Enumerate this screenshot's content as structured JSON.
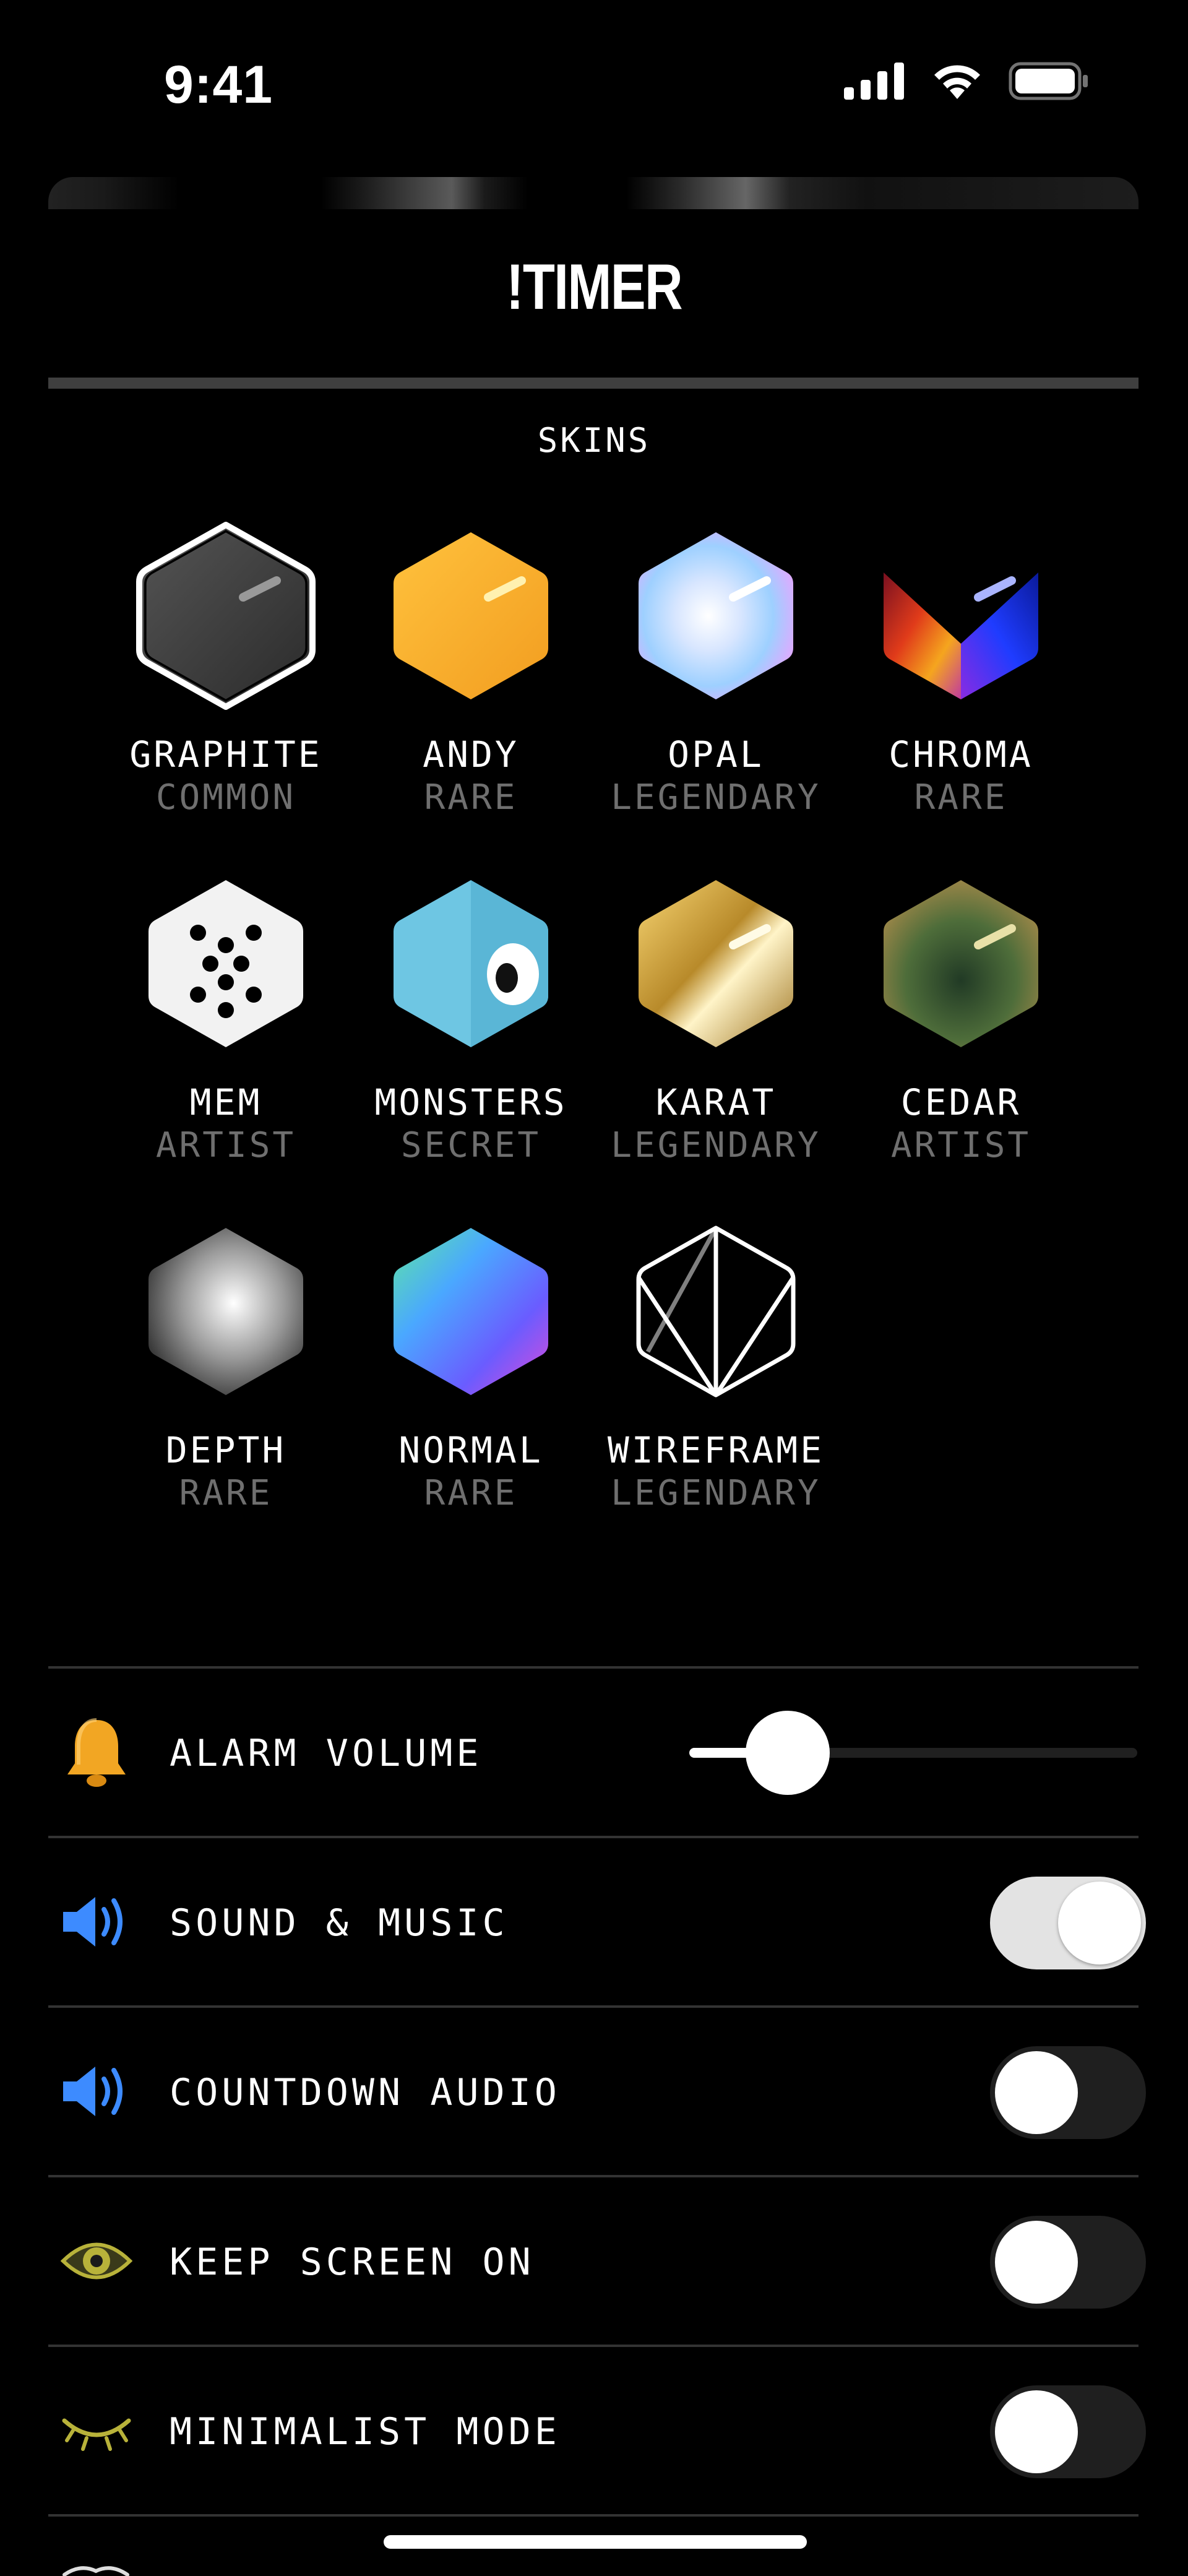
{
  "status_bar": {
    "time": "9:41"
  },
  "header": {
    "title": "!TIMER"
  },
  "skins": {
    "heading": "SKINS",
    "items": [
      {
        "name": "GRAPHITE",
        "rarity": "COMMON",
        "selected": true
      },
      {
        "name": "ANDY",
        "rarity": "RARE"
      },
      {
        "name": "OPAL",
        "rarity": "LEGENDARY"
      },
      {
        "name": "CHROMA",
        "rarity": "RARE"
      },
      {
        "name": "MEM",
        "rarity": "ARTIST"
      },
      {
        "name": "MONSTERS",
        "rarity": "SECRET"
      },
      {
        "name": "KARAT",
        "rarity": "LEGENDARY"
      },
      {
        "name": "CEDAR",
        "rarity": "ARTIST"
      },
      {
        "name": "DEPTH",
        "rarity": "RARE"
      },
      {
        "name": "NORMAL",
        "rarity": "RARE"
      },
      {
        "name": "WIREFRAME",
        "rarity": "LEGENDARY"
      }
    ]
  },
  "settings": {
    "alarm_volume": {
      "label": "ALARM VOLUME",
      "value": 0.22,
      "icon": "bell-icon"
    },
    "sound_music": {
      "label": "SOUND & MUSIC",
      "on": true,
      "icon": "speaker-icon"
    },
    "countdown_audio": {
      "label": "COUNTDOWN AUDIO",
      "on": false,
      "icon": "speaker-icon"
    },
    "keep_screen_on": {
      "label": "KEEP SCREEN ON",
      "on": false,
      "icon": "eye-icon"
    },
    "minimalist_mode": {
      "label": "MINIMALIST MODE",
      "on": false,
      "icon": "closed-eye-icon"
    }
  },
  "colors": {
    "background": "#000000",
    "accent_speaker": "#3d8bff",
    "bell": "#f2a623",
    "eye": "#b8b23a",
    "rarity_text": "#6f6f6f"
  }
}
